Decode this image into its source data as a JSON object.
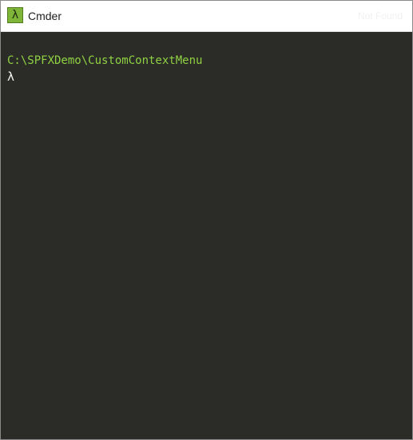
{
  "window": {
    "title": "Cmder",
    "icon": "lambda-icon",
    "icon_glyph": "λ",
    "title_right_ghost": "Not Found"
  },
  "console": {
    "current_directory": "C:\\SPFXDemo\\CustomContextMenu",
    "prompt_symbol": "λ"
  },
  "colors": {
    "console_background": "#2b2c27",
    "path_text": "#8fd142",
    "prompt_text": "#f4f4f4",
    "icon_background": "#7fb539"
  }
}
